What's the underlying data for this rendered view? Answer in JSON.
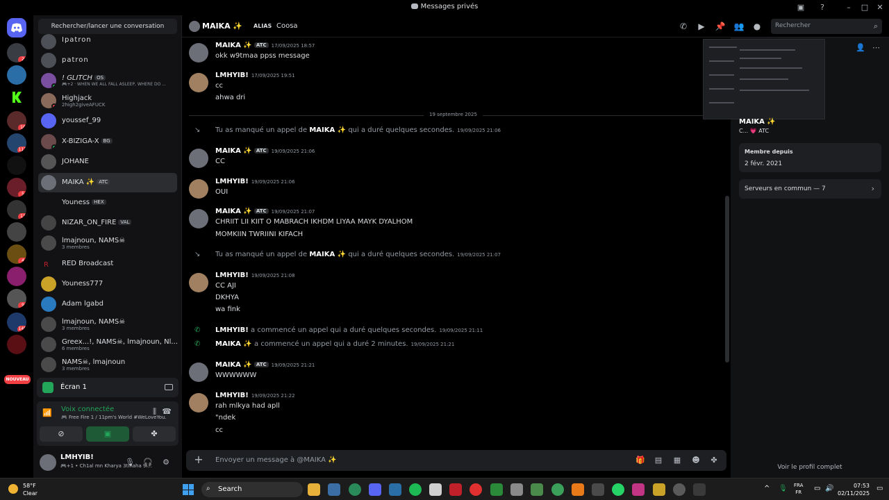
{
  "window": {
    "title": "Messages privés"
  },
  "servers": {
    "badges": [
      "2",
      "10",
      "117",
      "5",
      "13",
      "4",
      "9",
      "148"
    ],
    "new_label": "NOUVEAU"
  },
  "dm_list": {
    "search_label": "Rechercher/lancer une conversation",
    "items": [
      {
        "name": "Ipatron",
        "sub": "",
        "tag": ""
      },
      {
        "name": "patron",
        "sub": "",
        "tag": ""
      },
      {
        "name": "! GLITCH",
        "sub": "🎮+2 · WHEN WE ALL FALL ASLEEP, WHERE DO ...",
        "tag": "OS"
      },
      {
        "name": "Highjack",
        "sub": "2high2giveAFUCK",
        "tag": ""
      },
      {
        "name": "youssef_99",
        "sub": "",
        "tag": ""
      },
      {
        "name": "X-BIZIGA-X",
        "sub": "",
        "tag": "BG"
      },
      {
        "name": "JOHANE",
        "sub": "",
        "tag": ""
      },
      {
        "name": "MAIKA ✨",
        "sub": "",
        "tag": "ATC"
      },
      {
        "name": "Youness",
        "sub": "",
        "tag": "HEX"
      },
      {
        "name": "NIZAR_ON_FIRE",
        "sub": "",
        "tag": "VAL"
      },
      {
        "name": "lmajnoun, NAMS☠",
        "sub": "3 membres",
        "tag": ""
      },
      {
        "name": "RED Broadcast",
        "sub": "",
        "tag": ""
      },
      {
        "name": "Youness777",
        "sub": "",
        "tag": ""
      },
      {
        "name": "Adam lgabd",
        "sub": "",
        "tag": ""
      },
      {
        "name": "lmajnoun, NAMS☠",
        "sub": "3 membres",
        "tag": ""
      },
      {
        "name": "Greex...!, NAMS☠, lmajnoun, Nl...",
        "sub": "6 membres",
        "tag": ""
      },
      {
        "name": "NAMS☠, lmajnoun",
        "sub": "3 membres",
        "tag": ""
      }
    ]
  },
  "panel": {
    "stream_label": "Écran 1",
    "voice_status": "Voix connectée",
    "voice_channel": "🎮 Free Fire 1 / 11pm's World #WeLoveYou.",
    "user_name": "LMHYIB!",
    "user_status": "🎮+1 • Ch1al mn Kharya 3tinaha 9i..."
  },
  "chat": {
    "name": "MAIKA ✨",
    "alias_label": "ALIAS",
    "alias_value": "Coosa",
    "search_placeholder": "Rechercher",
    "date_divider": "19 septembre 2025",
    "composer_placeholder": "Envoyer un message à @MAIKA ✨",
    "messages": [
      {
        "author": "MAIKA ✨",
        "tag": "ATC",
        "time": "17/09/2025 18:57",
        "lines": [
          "okk w9tmaa ppss message"
        ]
      },
      {
        "author": "LMHYIB!",
        "tag": "",
        "time": "17/09/2025 19:51",
        "lines": [
          "cc",
          "ahwa dri"
        ]
      },
      {
        "author": "MAIKA ✨",
        "tag": "ATC",
        "time": "19/09/2025 21:06",
        "lines": [
          "CC"
        ]
      },
      {
        "author": "LMHYIB!",
        "tag": "",
        "time": "19/09/2025 21:06",
        "lines": [
          "OUI"
        ]
      },
      {
        "author": "MAIKA ✨",
        "tag": "ATC",
        "time": "19/09/2025 21:07",
        "lines": [
          "CHRIIT LII KIIT O MABRACH IKHDM LIYAA MAYK DYALHOM",
          "MOMKIIN TWRIINI KIFACH"
        ]
      },
      {
        "author": "LMHYIB!",
        "tag": "",
        "time": "19/09/2025 21:08",
        "lines": [
          "CC AJI",
          "DKHYA",
          "wa fink"
        ]
      },
      {
        "author": "MAIKA ✨",
        "tag": "ATC",
        "time": "19/09/2025 21:21",
        "lines": [
          "WWWWWW"
        ]
      },
      {
        "author": "LMHYIB!",
        "tag": "",
        "time": "19/09/2025 21:22",
        "lines": [
          "rah mlkya had apll",
          "\"ndek",
          "cc"
        ]
      }
    ],
    "system": [
      {
        "pre": "Tu as manqué un appel de ",
        "who": "MAIKA ✨",
        "post": " qui a duré quelques secondes.",
        "time": "19/09/2025 21:06"
      },
      {
        "pre": "Tu as manqué un appel de ",
        "who": "MAIKA ✨",
        "post": " qui a duré quelques secondes.",
        "time": "19/09/2025 21:07"
      },
      {
        "pre": "",
        "who": "LMHYIB!",
        "post": " a commencé un appel qui a duré quelques secondes.",
        "time": "19/09/2025 21:11"
      },
      {
        "pre": "",
        "who": "MAIKA ✨",
        "post": " a commencé un appel qui a duré 2 minutes.",
        "time": "19/09/2025 21:21"
      }
    ]
  },
  "profile": {
    "name": "MAIKA ✨",
    "tags": "C... 💗 ATC",
    "member_since_label": "Membre depuis",
    "member_since_value": "2 févr. 2021",
    "mutual_servers": "Serveurs en commun — 7",
    "full_profile": "Voir le profil complet"
  },
  "taskbar": {
    "temperature": "58°F",
    "condition": "Clear",
    "search_label": "Search",
    "lang_1": "FRA",
    "lang_2": "FR",
    "time": "07:53",
    "date": "02/11/2025"
  },
  "colors": {
    "accent": "#5865f2",
    "online": "#23a55a",
    "danger": "#f23f43",
    "background": "#000000"
  }
}
